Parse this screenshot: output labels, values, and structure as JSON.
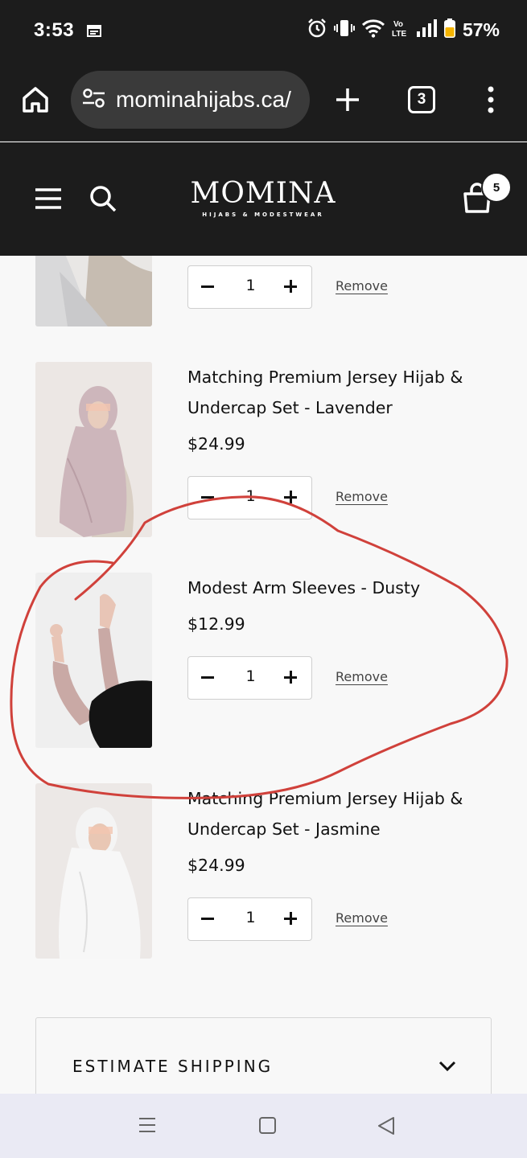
{
  "status_bar": {
    "time": "3:53",
    "battery": "57%",
    "battery_color": "#f5b400"
  },
  "browser": {
    "url": "mominahijabs.ca/",
    "tab_count": "3"
  },
  "site": {
    "logo": "MOMINA",
    "logo_tagline": "HIJABS & MODESTWEAR",
    "cart_count": "5"
  },
  "cart": {
    "remove_label": "Remove",
    "items": [
      {
        "title": "",
        "price": "",
        "quantity": "1",
        "thumb_colors": [
          "#d9d9da",
          "#c6bcb1"
        ]
      },
      {
        "title": "Matching Premium Jersey Hijab & Undercap Set - Lavender",
        "price": "$24.99",
        "quantity": "1",
        "thumb_colors": [
          "#ece7e4",
          "#cdb6bb"
        ]
      },
      {
        "title": "Modest Arm Sleeves - Dusty",
        "price": "$12.99",
        "quantity": "1",
        "thumb_colors": [
          "#efefef",
          "#c9a9a5"
        ]
      },
      {
        "title": "Matching Premium Jersey Hijab & Undercap Set - Jasmine",
        "price": "$24.99",
        "quantity": "1",
        "thumb_colors": [
          "#ece8e6",
          "#f4f4f4"
        ]
      }
    ]
  },
  "shipping": {
    "label": "ESTIMATE SHIPPING"
  },
  "annotation": {
    "color": "#d0413b",
    "shape": "hand-drawn circle around Modest Arm Sleeves - Dusty"
  }
}
